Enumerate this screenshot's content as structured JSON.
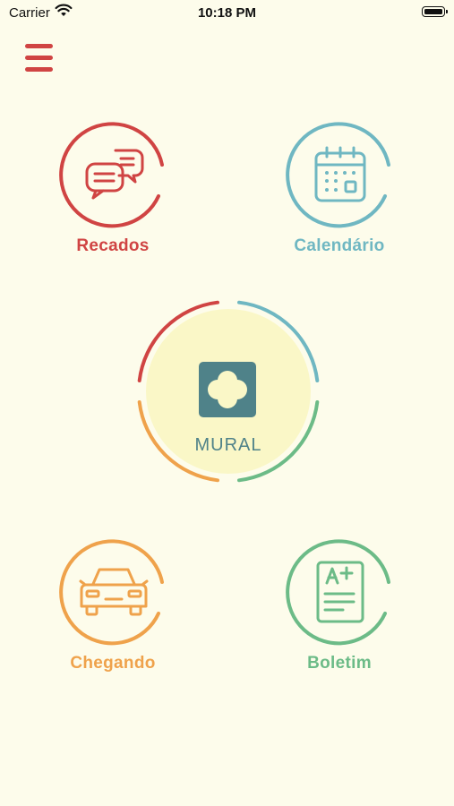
{
  "status_bar": {
    "carrier": "Carrier",
    "time": "10:18 PM"
  },
  "menu": {
    "icon": "hamburger-menu-icon"
  },
  "tiles": {
    "recados": {
      "label": "Recados",
      "icon": "chat-bubbles-icon",
      "color": "#D04443"
    },
    "calendario": {
      "label": "Calendário",
      "icon": "calendar-icon",
      "color": "#6FB7C2"
    },
    "chegando": {
      "label": "Chegando",
      "icon": "car-icon",
      "color": "#EFA24B"
    },
    "boletim": {
      "label": "Boletim",
      "icon": "report-card-icon",
      "color": "#6CBB87"
    }
  },
  "mural": {
    "label": "MURAL",
    "icon": "clover-icon",
    "color": "#4F8289"
  },
  "colors": {
    "background": "#FDFCEB",
    "mural_fill": "#FAF7C7"
  }
}
